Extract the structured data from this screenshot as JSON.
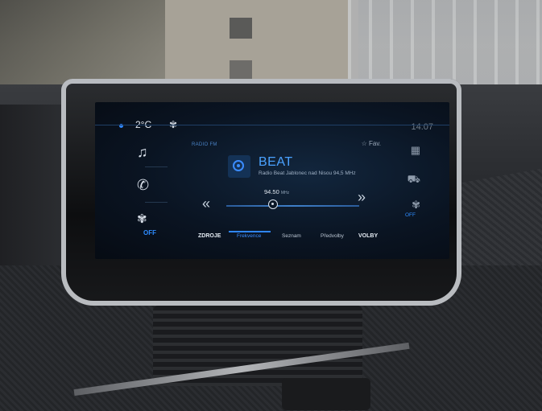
{
  "status_bar": {
    "temperature": "2°C",
    "clock": "14:07"
  },
  "left_panel": {
    "items": [
      {
        "icon": "music-icon"
      },
      {
        "icon": "phone-icon"
      },
      {
        "icon": "fan-icon",
        "label": "OFF"
      }
    ]
  },
  "radio": {
    "source_label": "RADIO FM",
    "station_name": "BEAT",
    "station_description": "Radio Beat Jablonec nad Nisou 94,5 MHz",
    "favorite_label": "Fav.",
    "frequency": "94.50",
    "frequency_unit": "MHz"
  },
  "right_panel": {
    "items": [
      {
        "icon": "grid-icon"
      },
      {
        "icon": "car-icon"
      },
      {
        "icon": "fan-icon",
        "label": "OFF"
      }
    ]
  },
  "bottom_tabs": [
    {
      "label": "ZDROJE",
      "bold": true
    },
    {
      "label": "Frekvence",
      "active": true
    },
    {
      "label": "Seznam"
    },
    {
      "label": "Předvolby"
    },
    {
      "label": "VOLBY",
      "bold": true
    }
  ],
  "colors": {
    "accent": "#2f86ff",
    "screen_bg": "#0a1422"
  }
}
